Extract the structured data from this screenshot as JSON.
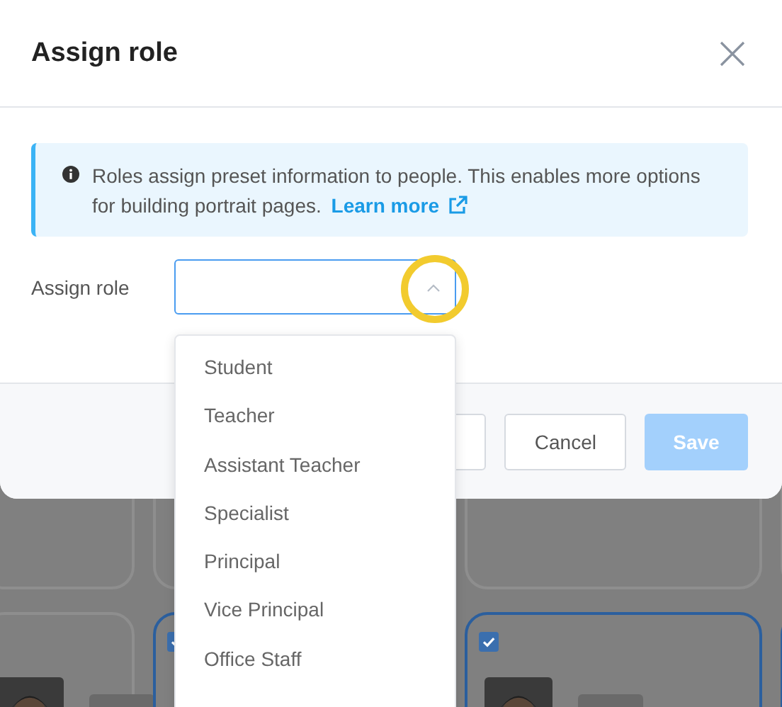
{
  "dialog": {
    "title": "Assign role",
    "info": {
      "text": "Roles assign preset information to people. This enables more options for building portrait pages.",
      "link": "Learn more"
    },
    "field": {
      "label": "Assign role",
      "expanded": true
    },
    "options": [
      "Student",
      "Teacher",
      "Assistant Teacher",
      "Specialist",
      "Principal",
      "Vice Principal",
      "Office Staff"
    ],
    "buttons": [
      {
        "label": "Cancel",
        "kind": "secondary",
        "disabled": false
      },
      {
        "label": "Save",
        "kind": "primary",
        "disabled": true
      }
    ]
  },
  "background_cards": [
    {
      "selected": false
    },
    {
      "selected": true
    },
    {
      "selected": true
    },
    {
      "selected": true
    }
  ]
}
